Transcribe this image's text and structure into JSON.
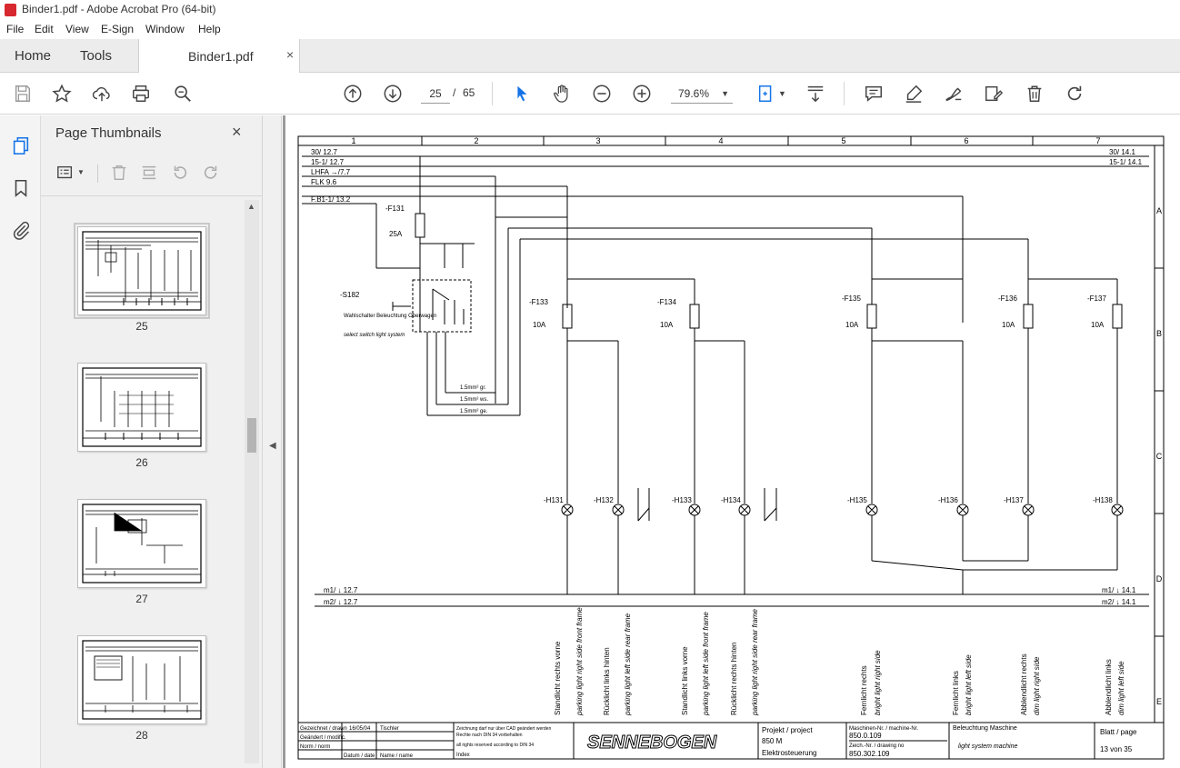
{
  "window": {
    "title": "Binder1.pdf - Adobe Acrobat Pro (64-bit)"
  },
  "menu": {
    "items": [
      "File",
      "Edit",
      "View",
      "E-Sign",
      "Window",
      "Help"
    ]
  },
  "tabs": {
    "home": "Home",
    "tools": "Tools",
    "document": "Binder1.pdf",
    "close": "×"
  },
  "toolbar": {
    "page_current": "25",
    "page_sep": "/",
    "page_total": "65",
    "zoom": "79.6%",
    "icons": [
      "save-icon",
      "bookmark-star-icon",
      "upload-icon",
      "print-icon",
      "zoom-search-icon",
      "prev-page-icon",
      "next-page-icon",
      "select-arrow-icon",
      "hand-icon",
      "zoom-out-icon",
      "zoom-in-icon",
      "fit-page-icon",
      "scroll-mode-icon",
      "comment-icon",
      "highlight-icon",
      "sign-icon",
      "edit-icon",
      "delete-icon",
      "rotate-icon"
    ]
  },
  "sidebar": {
    "title": "Page Thumbnails",
    "close": "×",
    "thumbnails": [
      {
        "label": "25",
        "selected": true
      },
      {
        "label": "26",
        "selected": false
      },
      {
        "label": "27",
        "selected": false
      },
      {
        "label": "28",
        "selected": false
      }
    ]
  },
  "colors": {
    "accent": "#1473e6",
    "chrome": "#ececec",
    "panel": "#f0f0f0",
    "doc_bg": "#9b9b9b"
  },
  "document": {
    "columns": [
      "1",
      "2",
      "3",
      "4",
      "5",
      "6",
      "7"
    ],
    "rows": [
      "A",
      "B",
      "C",
      "D",
      "E"
    ],
    "left_buses": [
      "30/ 12.7",
      "15-1/ 12.7",
      "LHFA →/7.7",
      "FLK 9.6",
      "F.B1-1/ 13.2"
    ],
    "right_buses": [
      "30/ 14.1",
      "15-1/ 14.1"
    ],
    "bottom_buses_left": [
      "m1/ ↓ 12.7",
      "m2/ ↓ 12.7"
    ],
    "bottom_buses_right": [
      "m1/ ↓ 14.1",
      "m2/ ↓ 14.1"
    ],
    "fuse_main": {
      "name": "-F131",
      "rating": "25A"
    },
    "switch": {
      "name": "-S182",
      "label_de": "Wahlschalter Beleuchtung Oberwagen",
      "label_en": "select switch light system"
    },
    "wires": [
      "1.5mm² gr.",
      "1.5mm² ws.",
      "1.5mm² ge."
    ],
    "fuses": [
      {
        "name": "-F133",
        "rating": "10A"
      },
      {
        "name": "-F134",
        "rating": "10A"
      },
      {
        "name": "-F135",
        "rating": "10A"
      },
      {
        "name": "-F136",
        "rating": "10A"
      },
      {
        "name": "-F137",
        "rating": "10A"
      }
    ],
    "lamps": [
      "-H131",
      "-H132",
      "-H133",
      "-H134",
      "-H135",
      "-H136",
      "-H137",
      "-H138"
    ],
    "descriptions": [
      {
        "de": "Standlicht rechts vorne",
        "en": "parking light right side front frame"
      },
      {
        "de": "Rücklicht links hinten",
        "en": "parking light left side rear frame"
      },
      {
        "de": "Standlicht links vorne",
        "en": "parking light left side front frame"
      },
      {
        "de": "Rücklicht rechts hinten",
        "en": "parking light right side rear frame"
      },
      {
        "de": "Fernlicht rechts",
        "en": "bright light right side"
      },
      {
        "de": "Fernlicht links",
        "en": "bright light left side"
      },
      {
        "de": "Abblendlicht rechts",
        "en": "dim light right side"
      },
      {
        "de": "Abblendlicht links",
        "en": "dim light left side"
      }
    ],
    "titleblock": {
      "company": "SENNEBOGEN",
      "project_label": "Projekt / project",
      "project_value": "850 M",
      "project_sub": "Elektrosteuerung",
      "machine_label": "Maschinen-Nr. / machine-Nr.",
      "machine_value": "850.0.109",
      "drawing_label": "Zeich.-Nr. / drawing no",
      "drawing_value": "850.302.109",
      "title_de": "Beleuchtung Maschine",
      "title_en": "light system machine",
      "sheet_label": "Blatt / page",
      "sheet_value": "13 von 35",
      "drawn": "Gezeichnet / drawn",
      "date": "16/05/04",
      "name": "Tischler",
      "modified": "Geändert / modific.",
      "norm": "Norm / norm",
      "date_label": "Datum / date",
      "name_label": "Name / name",
      "index_label": "Index",
      "rights1": "Zeichnung darf nur über CAD geändert werden",
      "rights2": "Rechte nach DIN 34 vorbehalten",
      "rights3": "all rights reserved according to DIN 34"
    }
  }
}
